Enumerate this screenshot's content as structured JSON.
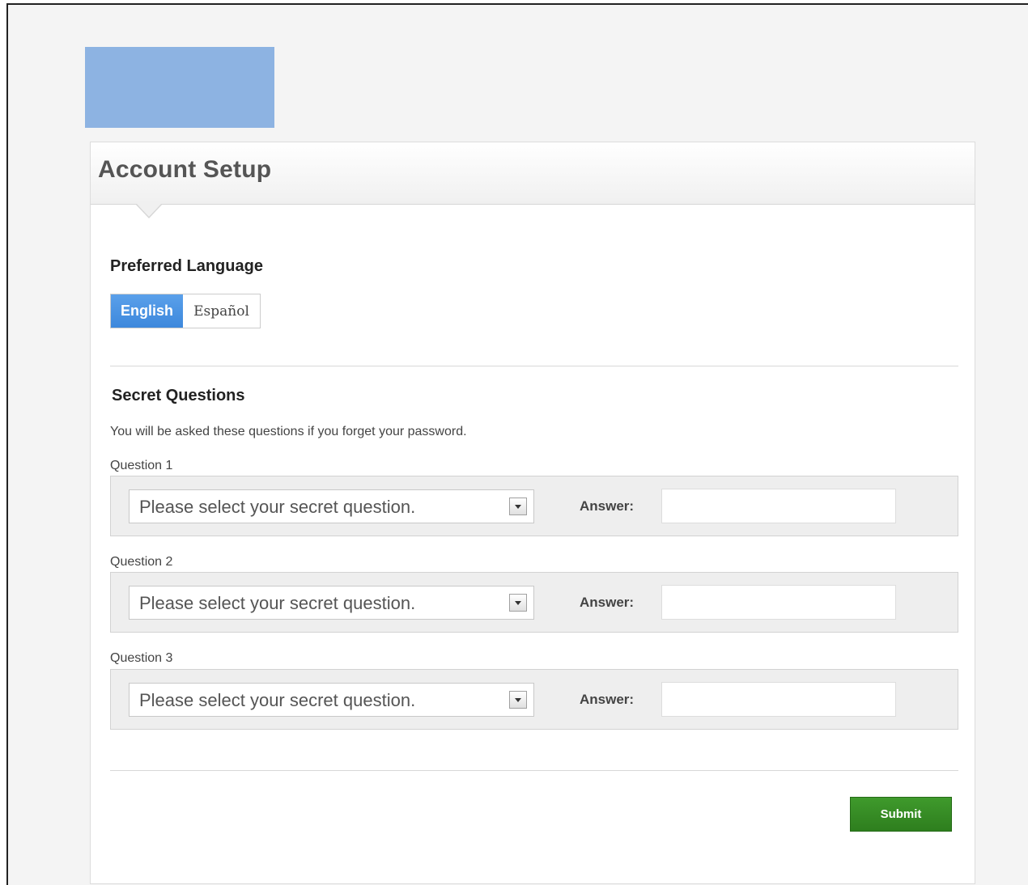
{
  "header": {
    "title": "Account Setup"
  },
  "language": {
    "heading": "Preferred Language",
    "options": [
      "English",
      "Español"
    ],
    "selected": "English"
  },
  "secret_questions": {
    "heading": "Secret Questions",
    "helper": "You will be asked these questions if you forget your password.",
    "answer_label": "Answer:",
    "questions": [
      {
        "label": "Question 1",
        "select_value": "Please select your secret question.",
        "answer_value": ""
      },
      {
        "label": "Question 2",
        "select_value": "Please select your secret question.",
        "answer_value": ""
      },
      {
        "label": "Question 3",
        "select_value": "Please select your secret question.",
        "answer_value": ""
      }
    ]
  },
  "footer": {
    "submit_label": "Submit"
  },
  "colors": {
    "logo_placeholder": "#8db3e2",
    "selected_language": "#4a94e4",
    "submit": "#358a24"
  },
  "icons": {
    "dropdown": "chevron-down-icon"
  }
}
